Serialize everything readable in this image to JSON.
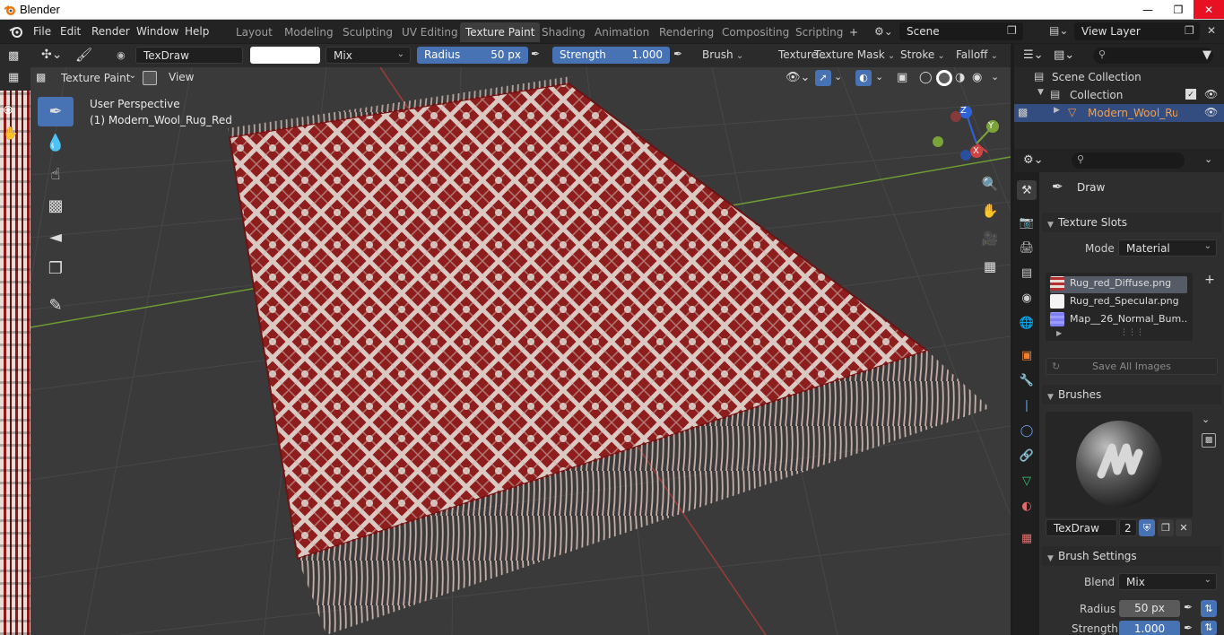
{
  "window": {
    "title": "Blender"
  },
  "menu": [
    "File",
    "Edit",
    "Render",
    "Window",
    "Help"
  ],
  "workspaces": {
    "tabs": [
      "Layout",
      "Modeling",
      "Sculpting",
      "UV Editing",
      "Texture Paint",
      "Shading",
      "Animation",
      "Rendering",
      "Compositing",
      "Scripting"
    ],
    "active": "Texture Paint"
  },
  "scene": {
    "name": "Scene"
  },
  "view_layer": {
    "name": "View Layer"
  },
  "tool_header": {
    "brush_name": "TexDraw",
    "blend": "Mix",
    "radius_label": "Radius",
    "radius_value": "50 px",
    "strength_label": "Strength",
    "strength_value": "1.000",
    "dropdowns": [
      "Brush",
      "Texture",
      "Texture Mask",
      "Stroke",
      "Falloff"
    ]
  },
  "viewport_header": {
    "mode": "Texture Paint",
    "view_menu": "View"
  },
  "viewport": {
    "perspective": "User Perspective",
    "object_line": "(1) Modern_Wool_Rug_Red",
    "gizmo": {
      "x": "X",
      "y": "Y",
      "z": "Z"
    }
  },
  "outliner": {
    "rows": [
      "Scene Collection",
      "Collection",
      "Modern_Wool_Rug_R"
    ]
  },
  "properties": {
    "brush_title": "Draw",
    "texture_slots": {
      "title": "Texture Slots",
      "mode_label": "Mode",
      "mode_value": "Material",
      "items": [
        "Rug_red_Diffuse.png",
        "Rug_red_Specular.png",
        "Map__26_Normal_Bum..."
      ],
      "save_all": "Save All Images"
    },
    "brushes": {
      "title": "Brushes",
      "brush_name": "TexDraw",
      "users": "2"
    },
    "brush_settings": {
      "title": "Brush Settings",
      "blend_label": "Blend",
      "blend_value": "Mix",
      "radius_label": "Radius",
      "radius_value": "50 px",
      "strength_label": "Strength",
      "strength_value": "1.000"
    }
  },
  "colors": {
    "accent": "#4772b3",
    "selection": "#334d80",
    "rug_red": "#8e1d1d",
    "rug_cream": "#d9c9c2"
  }
}
